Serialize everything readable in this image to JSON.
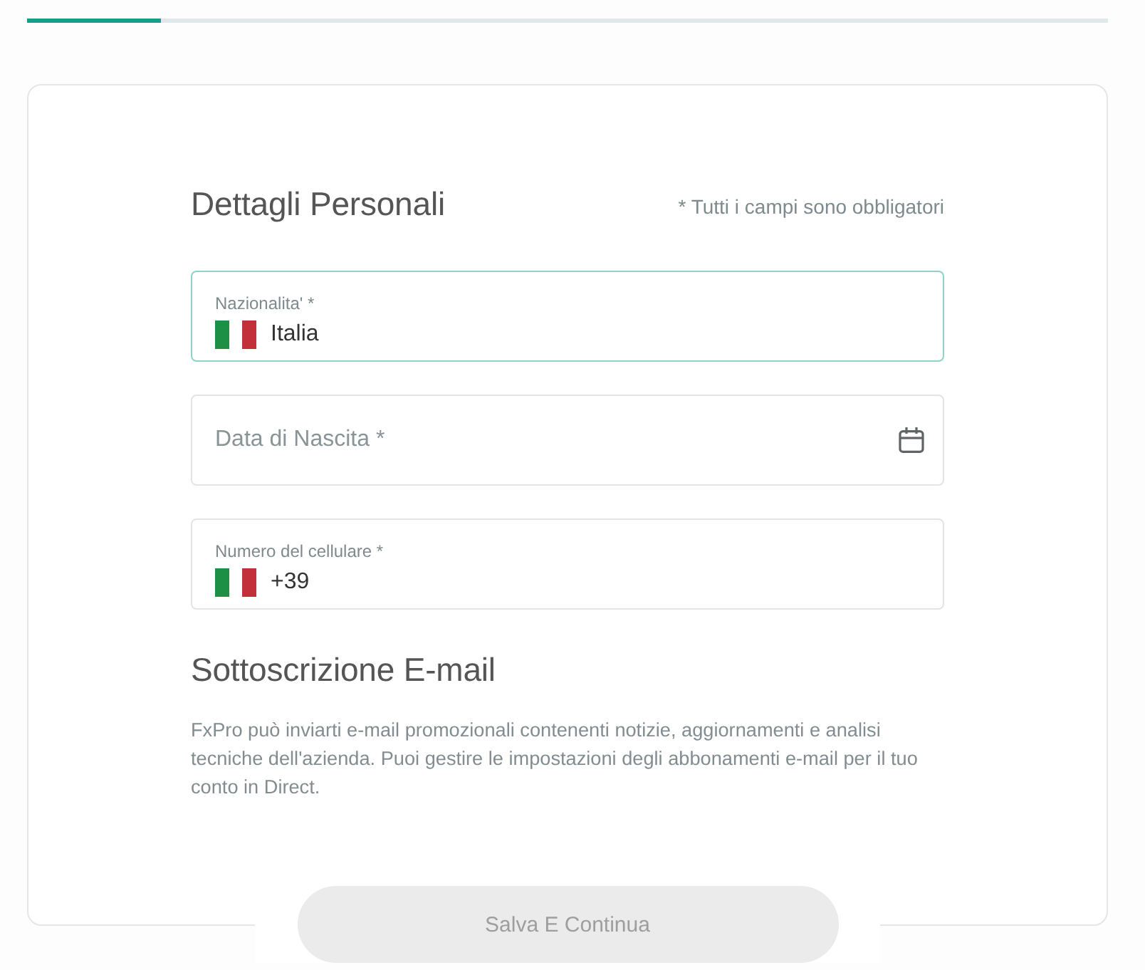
{
  "progress": {
    "level": 0.124
  },
  "personal_details": {
    "title": "Dettagli Personali",
    "required_note": "* Tutti i campi sono obbligatori",
    "fields": [
      {
        "kind": "select",
        "label": "Nazionalita' *",
        "value": "Italia",
        "focused": true
      },
      {
        "kind": "date",
        "placeholder": "Data di Nascita *",
        "focused": false
      },
      {
        "kind": "phone",
        "label": "Numero del cellulare *",
        "value": "+39",
        "focused": false
      }
    ]
  },
  "email_subscription": {
    "title": "Sottoscrizione E-mail",
    "description": "FxPro può inviarti e-mail promozionali contenenti notizie, aggiornamenti e analisi tecniche dell'azienda. Puoi gestire le impostazioni degli abbonamenti e-mail per il tuo conto in Direct."
  },
  "save_button": {
    "label": "Salva E Continua",
    "disabled": true
  }
}
